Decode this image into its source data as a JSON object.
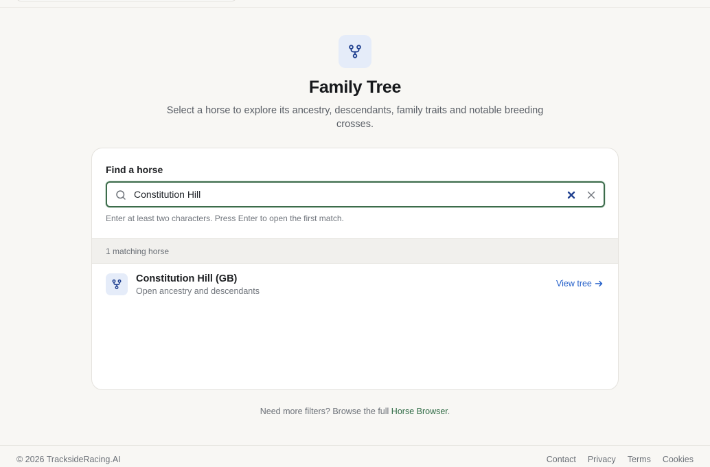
{
  "page": {
    "title": "Family Tree",
    "subtitle": "Select a horse to explore its ancestry, descendants, family traits and notable breeding crosses.",
    "icon": "family-tree-icon"
  },
  "search": {
    "label": "Find a horse",
    "value": "Constitution Hill",
    "hint": "Enter at least two characters. Press Enter to open the first match."
  },
  "results": {
    "count_label": "1 matching horse",
    "items": [
      {
        "name": "Constitution Hill (GB)",
        "subtitle": "Open ancestry and descendants",
        "action": "View tree",
        "icon": "family-tree-icon"
      }
    ]
  },
  "more_filters": {
    "text": "Need more filters? Browse the full ",
    "link": "Horse Browser",
    "suffix": "."
  },
  "footer": {
    "copyright": "© 2026 TracksideRacing.AI",
    "links": [
      "Contact",
      "Privacy",
      "Terms",
      "Cookies"
    ]
  },
  "colors": {
    "accent_blue": "#1f5cc8",
    "accent_green": "#3c6b4b",
    "icon_bg": "#e5ecf9",
    "background": "#f8f7f4"
  }
}
